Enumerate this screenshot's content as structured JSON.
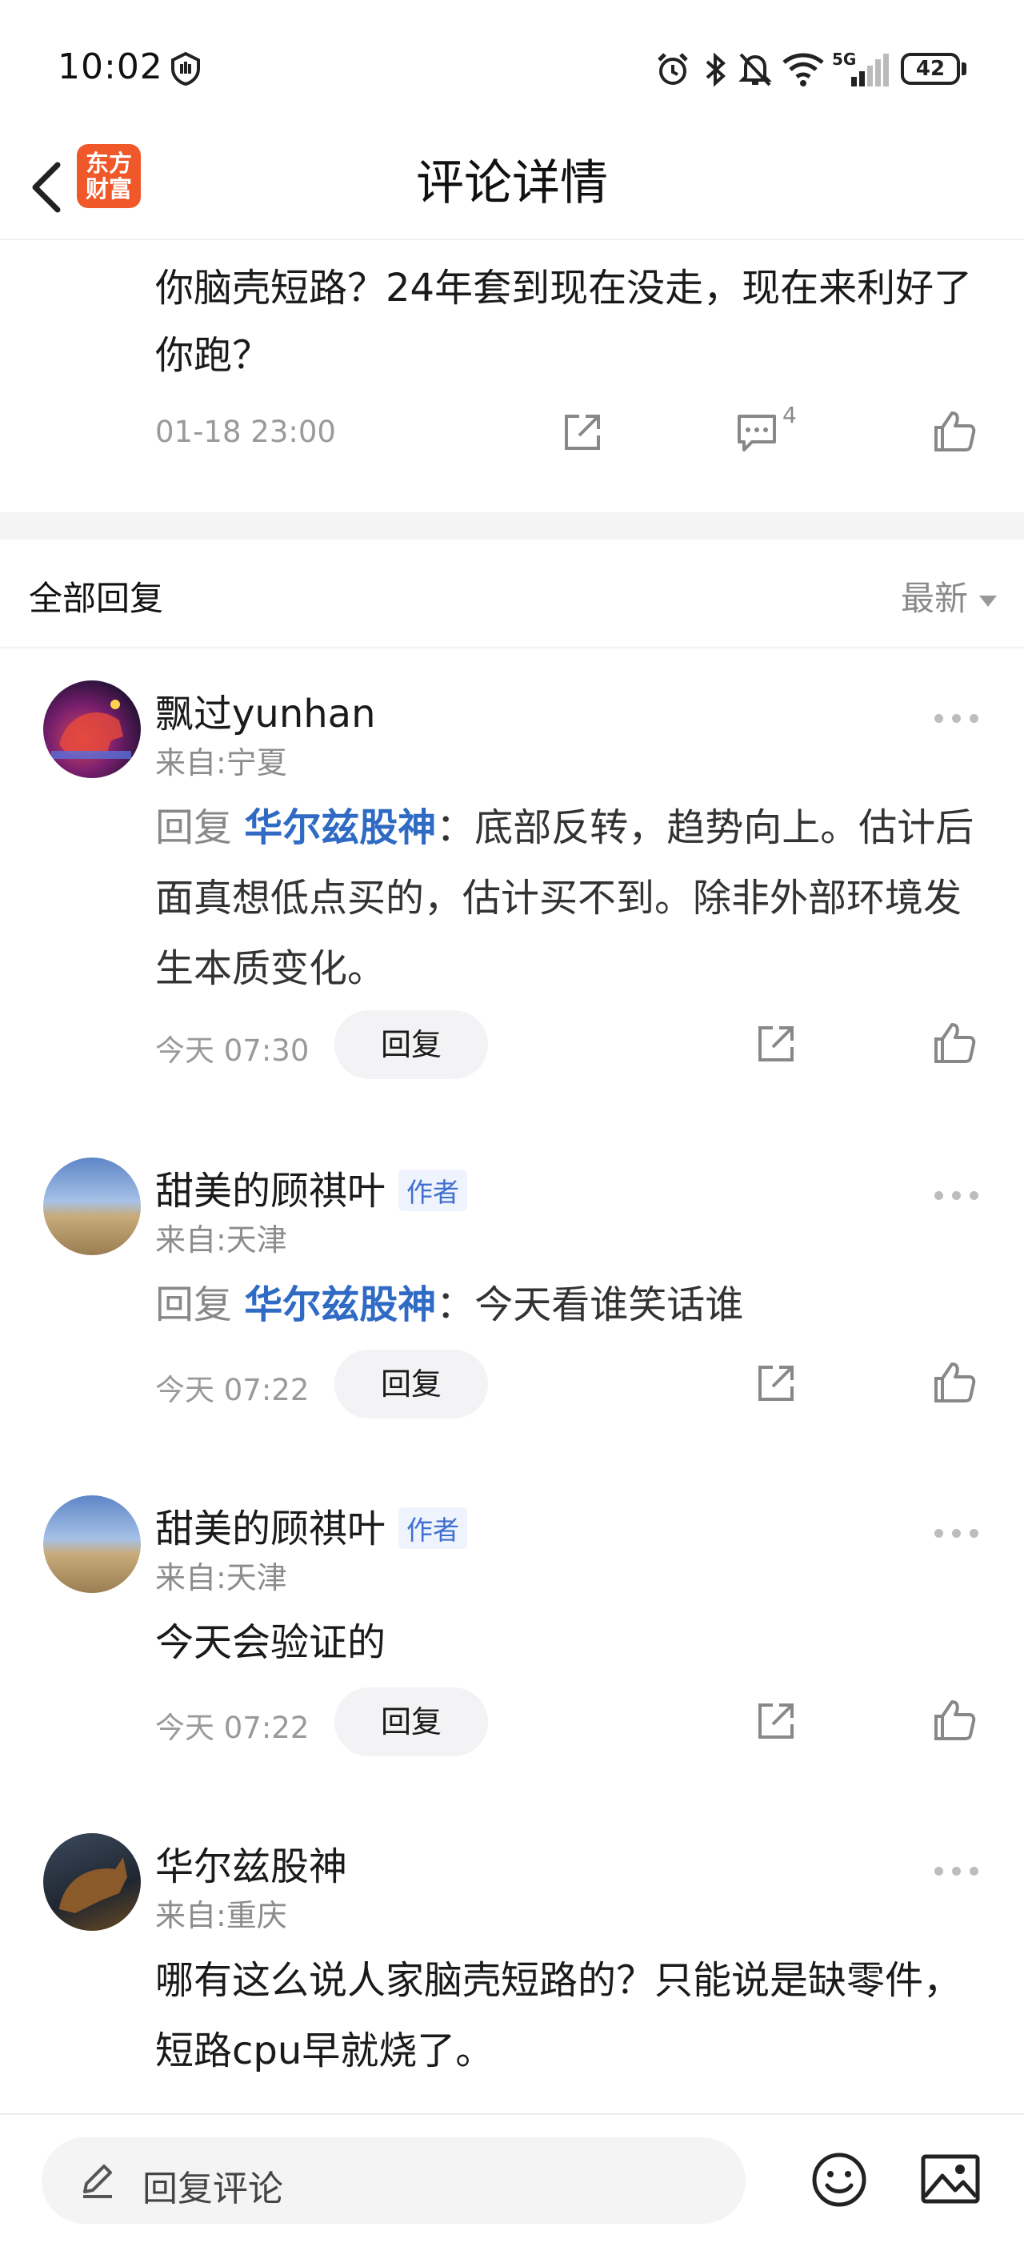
{
  "status_bar": {
    "time": "10:02",
    "icons": [
      "shield-icon",
      "alarm-icon",
      "bluetooth-icon",
      "mute-icon",
      "wifi-icon",
      "signal-5g-icon",
      "battery-icon"
    ],
    "network": "5G",
    "battery": "42"
  },
  "header": {
    "title": "评论详情",
    "logo_line1": "东方",
    "logo_line2": "财富"
  },
  "main_comment": {
    "text": "你脑壳短路？24年套到现在没走，现在来利好了你跑？",
    "time": "01-18 23:00",
    "comment_count": "4"
  },
  "replies_section": {
    "title": "全部回复",
    "sort": "最新"
  },
  "replies": [
    {
      "username": "飘过yunhan",
      "is_author": false,
      "location": "来自:宁夏",
      "reply_prefix": "回复",
      "mention": "华尔兹股神",
      "text": "：底部反转，趋势向上。估计后面真想低点买的，估计买不到。除非外部环境发生本质变化。",
      "time": "今天 07:30",
      "reply_label": "回复"
    },
    {
      "username": "甜美的顾祺叶",
      "is_author": true,
      "author_badge": "作者",
      "location": "来自:天津",
      "reply_prefix": "回复",
      "mention": "华尔兹股神",
      "text": "：今天看谁笑话谁",
      "time": "今天 07:22",
      "reply_label": "回复"
    },
    {
      "username": "甜美的顾祺叶",
      "is_author": true,
      "author_badge": "作者",
      "location": "来自:天津",
      "text": "今天会验证的",
      "time": "今天 07:22",
      "reply_label": "回复"
    },
    {
      "username": "华尔兹股神",
      "is_author": false,
      "location": "来自:重庆",
      "text": "哪有这么说人家脑壳短路的？只能说是缺零件，短路cpu早就烧了。"
    }
  ],
  "bottom_bar": {
    "placeholder": "回复评论"
  },
  "colors": {
    "mention": "#2f6ac4",
    "logo": "#f0582a",
    "author_badge_bg": "#eef3fd"
  }
}
